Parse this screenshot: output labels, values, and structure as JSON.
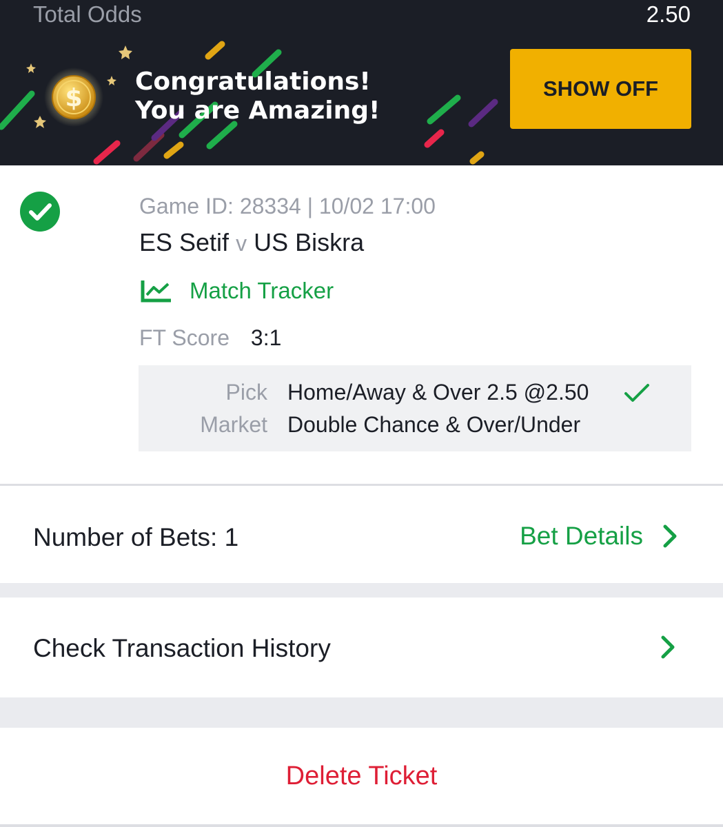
{
  "summary": {
    "total_odds_label": "Total Odds",
    "total_odds_value": "2.50"
  },
  "banner": {
    "line1": "Congratulations!",
    "line2": "You are Amazing!",
    "show_off_label": "SHOW OFF",
    "coin_icon": "dollar-coin-icon",
    "show_off_color": "#f1b000"
  },
  "match": {
    "status_icon": "check-circle-icon",
    "game_id": "Game ID: 28334 | 10/02 17:00",
    "home": "ES Setif",
    "separator": "v",
    "away": "US Biskra",
    "tracker_label": "Match Tracker",
    "tracker_icon": "line-chart-icon",
    "ft_label": "FT Score",
    "ft_value": "3:1",
    "pick_label": "Pick",
    "pick_value": "Home/Away & Over 2.5 @2.50",
    "market_label": "Market",
    "market_value": "Double Chance & Over/Under"
  },
  "bets": {
    "count_label": "Number of Bets: 1",
    "details_label": "Bet Details"
  },
  "history": {
    "label": "Check Transaction History"
  },
  "actions": {
    "delete_label": "Delete Ticket"
  },
  "colors": {
    "accent_green": "#15a045",
    "danger_red": "#de1e35",
    "banner_bg": "#1b1e26"
  }
}
